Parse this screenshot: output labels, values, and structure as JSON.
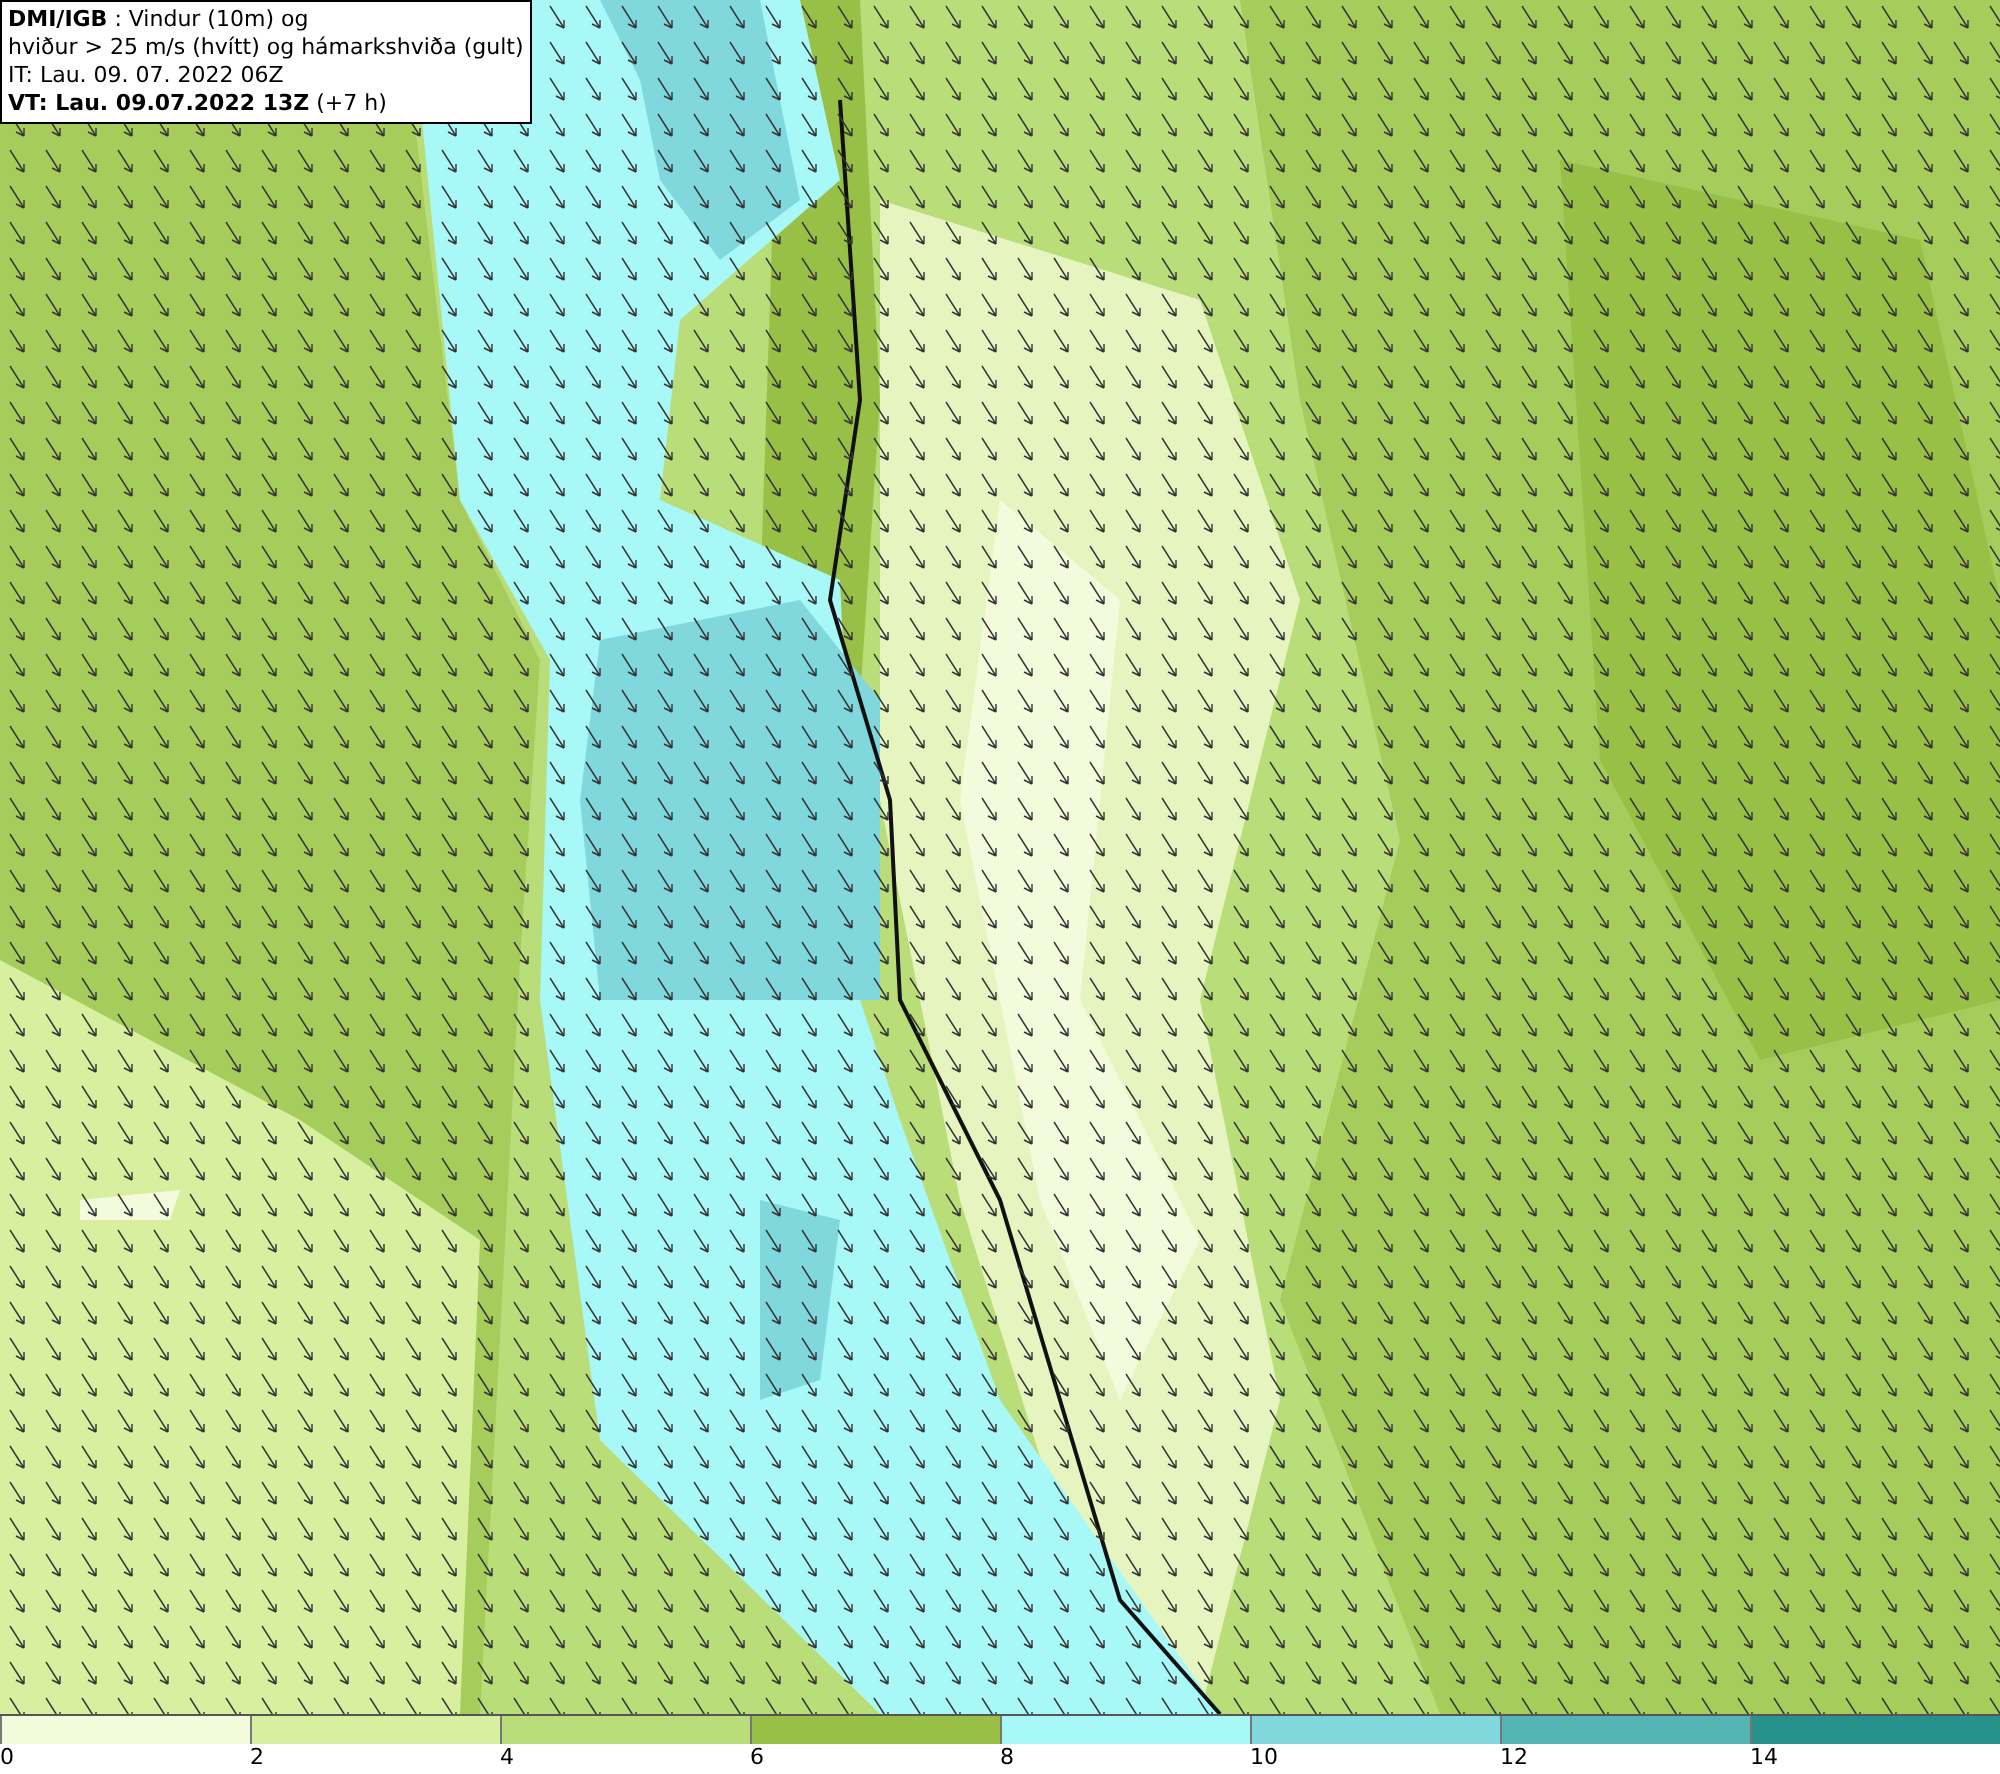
{
  "title_box": {
    "lines": [
      "**DMI/IGB** : Vindur (10m) og",
      "hviður > 25 m/s (hvítt) og hámarkshviða (gult)",
      "IT: Lau. 09. 07. 2022 06Z",
      "**VT: Lau. 09.07.2022 13Z** (+7 h)"
    ]
  },
  "legend": {
    "bins": [
      {
        "label": "0",
        "color": "#f4fbdc"
      },
      {
        "label": "2",
        "color": "#d7ef9f"
      },
      {
        "label": "4",
        "color": "#b9dd78"
      },
      {
        "label": "6",
        "color": "#98c046"
      },
      {
        "label": "8",
        "color": "#a8f8f8"
      },
      {
        "label": "10",
        "color": "#80d8dc"
      },
      {
        "label": "12",
        "color": "#55b5b5"
      },
      {
        "label": "14",
        "color": "#27918c"
      }
    ]
  }
}
